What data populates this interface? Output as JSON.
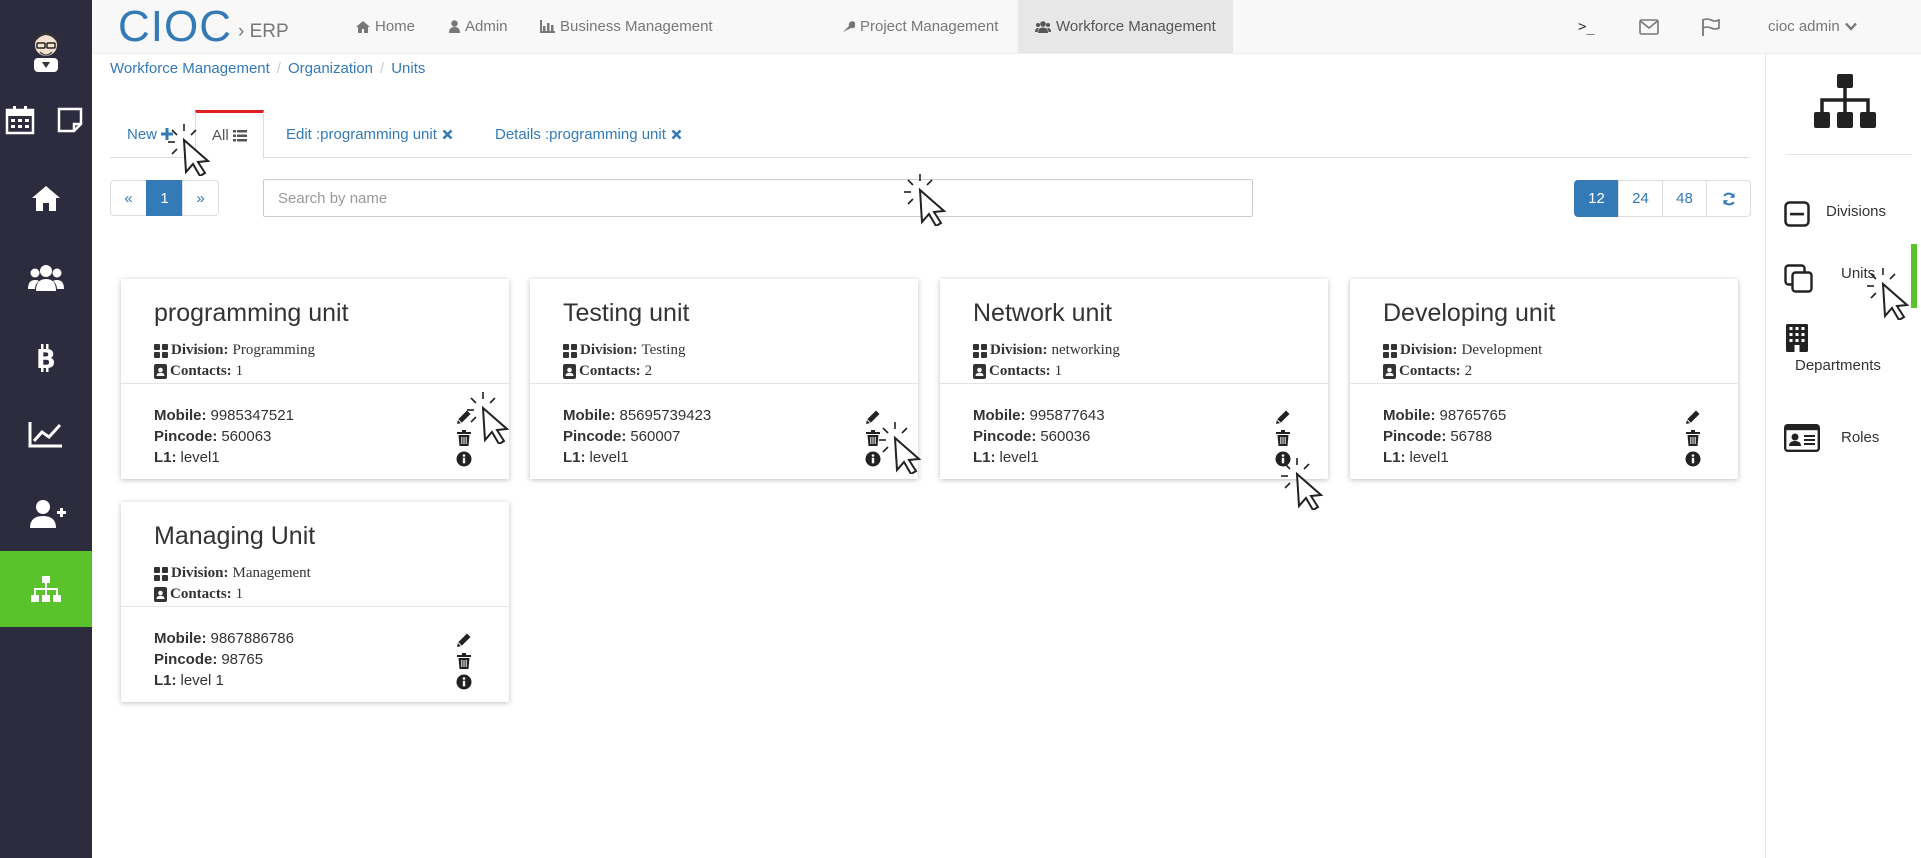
{
  "app": {
    "brand": "CIOC",
    "brand_sep": "›",
    "brand_sub": "ERP"
  },
  "topnav": {
    "items": [
      {
        "label": "Home",
        "icon": "home-icon"
      },
      {
        "label": "Admin",
        "icon": "user-icon"
      },
      {
        "label": "Business Management",
        "icon": "chart-icon"
      },
      {
        "label": "Project Management",
        "icon": "wrench-icon"
      },
      {
        "label": "Workforce Management",
        "icon": "users-icon",
        "active": true
      }
    ],
    "terminal": ">_",
    "user": "cioc admin"
  },
  "breadcrumb": [
    "Workforce Management",
    "Organization",
    "Units"
  ],
  "tabs": {
    "new_label": "New",
    "all_label": "All",
    "edit_label": "Edit :programming unit",
    "details_label": "Details :programming unit"
  },
  "pager": {
    "prev": "«",
    "current": "1",
    "next": "»"
  },
  "search": {
    "placeholder": "Search by name",
    "value": ""
  },
  "pagesize": {
    "options": [
      "12",
      "24",
      "48"
    ],
    "selected": "12"
  },
  "labels": {
    "division": "Division:",
    "contacts": "Contacts:",
    "mobile": "Mobile:",
    "pincode": "Pincode:",
    "l1": "L1:"
  },
  "units": [
    {
      "name": "programming unit",
      "division": "Programming",
      "contacts": "1",
      "mobile": "9985347521",
      "pincode": "560063",
      "l1": "level1"
    },
    {
      "name": "Testing unit",
      "division": "Testing",
      "contacts": "2",
      "mobile": "85695739423",
      "pincode": "560007",
      "l1": "level1"
    },
    {
      "name": "Network unit",
      "division": "networking",
      "contacts": "1",
      "mobile": "995877643",
      "pincode": "560036",
      "l1": "level1"
    },
    {
      "name": "Developing unit",
      "division": "Development",
      "contacts": "2",
      "mobile": "98765765",
      "pincode": "56788",
      "l1": "level1"
    },
    {
      "name": "Managing Unit",
      "division": "Management",
      "contacts": "1",
      "mobile": "9867886786",
      "pincode": "98765",
      "l1": "level 1"
    }
  ],
  "rightpanel": {
    "items": [
      "Divisions",
      "Units",
      "Departments",
      "Roles"
    ]
  },
  "colors": {
    "primary": "#337ab7",
    "sidebar": "#2d2c3f",
    "accent_green": "#5ac22a",
    "tab_active_top": "#e02020"
  }
}
